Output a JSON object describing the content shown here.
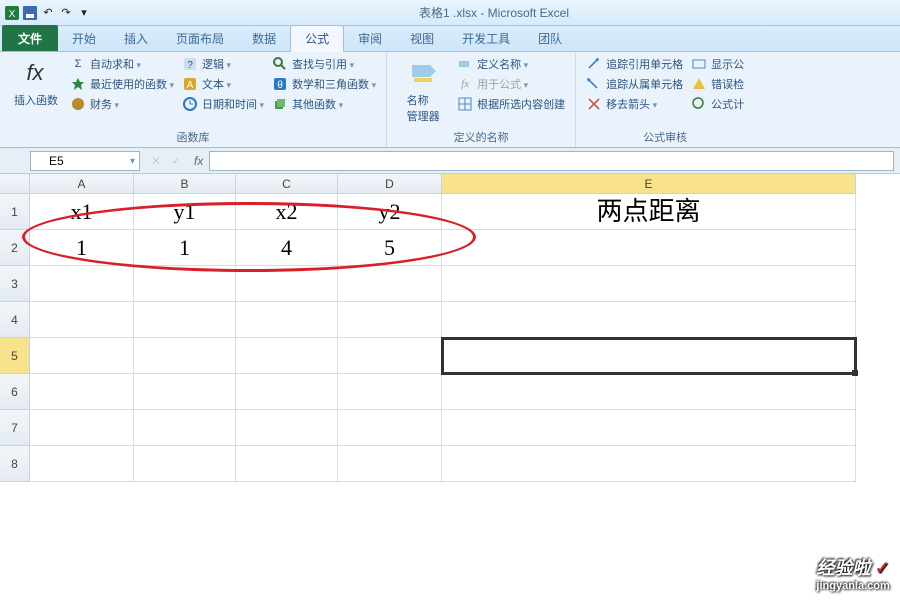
{
  "window": {
    "title": "表格1 .xlsx - Microsoft Excel"
  },
  "tabs": {
    "file": "文件",
    "items": [
      "开始",
      "插入",
      "页面布局",
      "数据",
      "公式",
      "审阅",
      "视图",
      "开发工具",
      "团队"
    ],
    "active_index": 4
  },
  "ribbon": {
    "insertfn": "插入函数",
    "col1": {
      "a": "自动求和",
      "b": "最近使用的函数",
      "c": "财务"
    },
    "col2": {
      "a": "逻辑",
      "b": "文本",
      "c": "日期和时间"
    },
    "col3": {
      "a": "查找与引用",
      "b": "数学和三角函数",
      "c": "其他函数"
    },
    "group1_label": "函数库",
    "namemgr": "名称\n管理器",
    "col4": {
      "a": "定义名称",
      "b": "用于公式",
      "c": "根据所选内容创建"
    },
    "group2_label": "定义的名称",
    "col5": {
      "a": "追踪引用单元格",
      "b": "追踪从属单元格",
      "c": "移去箭头"
    },
    "col6": {
      "a": "显示公",
      "b": "错误检",
      "c": "公式计"
    },
    "group3_label": "公式审核"
  },
  "namebox": "E5",
  "grid": {
    "cols": [
      "A",
      "B",
      "C",
      "D",
      "E"
    ],
    "rows": [
      "1",
      "2",
      "3",
      "4",
      "5",
      "6",
      "7",
      "8"
    ],
    "r1": {
      "A": "x1",
      "B": "y1",
      "C": "x2",
      "D": "y2",
      "E": "两点距离"
    },
    "r2": {
      "A": "1",
      "B": "1",
      "C": "4",
      "D": "5"
    },
    "selected": "E5"
  },
  "watermark": {
    "main": "经验啦",
    "check": "✓",
    "sub": "jingyanla.com"
  }
}
